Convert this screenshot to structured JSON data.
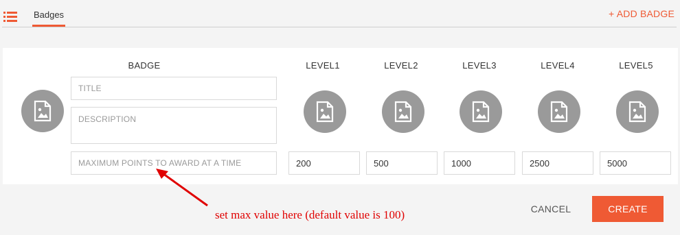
{
  "header": {
    "tab_label": "Badges",
    "add_badge_label": "+ ADD BADGE",
    "accent_color": "#ef5a34"
  },
  "form": {
    "badge_header": "BADGE",
    "title_placeholder": "TITLE",
    "description_placeholder": "DESCRIPTION",
    "max_points_placeholder": "MAXIMUM POINTS TO AWARD AT A TIME",
    "levels": [
      {
        "label": "LEVEL1",
        "value": "200"
      },
      {
        "label": "LEVEL2",
        "value": "500"
      },
      {
        "label": "LEVEL3",
        "value": "1000"
      },
      {
        "label": "LEVEL4",
        "value": "2500"
      },
      {
        "label": "LEVEL5",
        "value": "5000"
      }
    ]
  },
  "footer": {
    "cancel_label": "CANCEL",
    "create_label": "CREATE"
  },
  "annotation": {
    "text": "set max value here (default value is 100)",
    "color": "#e00000"
  },
  "icons": {
    "menu": "list-icon",
    "badge_image": "image-placeholder-icon"
  }
}
